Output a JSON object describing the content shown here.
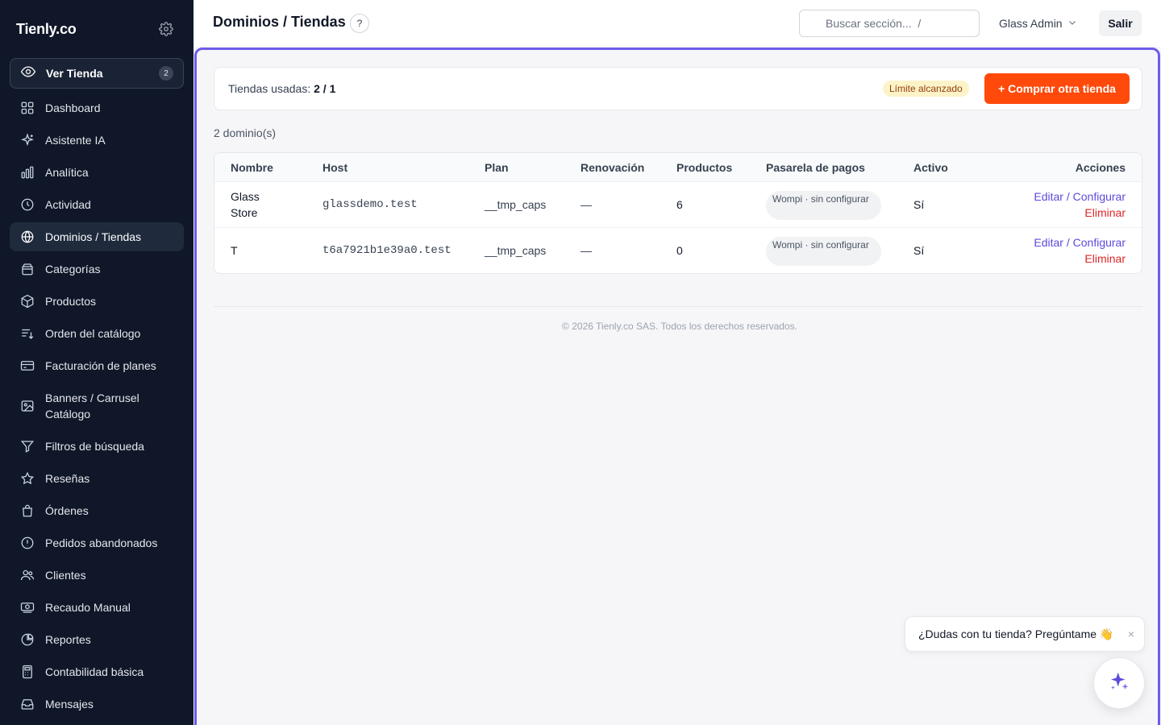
{
  "sidebar": {
    "brand": "Tienly.co",
    "settings_icon": "gear-icon",
    "ver_tienda": {
      "label": "Ver Tienda",
      "count": "2",
      "icon": "eye-icon"
    },
    "items": [
      {
        "label": "Dashboard",
        "icon": "grid-icon",
        "active": false
      },
      {
        "label": "Asistente IA",
        "icon": "sparkles-icon",
        "active": false
      },
      {
        "label": "Analítica",
        "icon": "bar-chart-icon",
        "active": false
      },
      {
        "label": "Actividad",
        "icon": "clock-icon",
        "active": false
      },
      {
        "label": "Dominios / Tiendas",
        "icon": "globe-icon",
        "active": true
      },
      {
        "label": "Categorías",
        "icon": "folder-icon",
        "active": false
      },
      {
        "label": "Productos",
        "icon": "box-icon",
        "active": false
      },
      {
        "label": "Orden del catálogo",
        "icon": "sort-list-icon",
        "active": false
      },
      {
        "label": "Facturación de planes",
        "icon": "credit-card-icon",
        "active": false
      },
      {
        "label": "Banners / Carrusel Catálogo",
        "icon": "image-icon",
        "active": false
      },
      {
        "label": "Filtros de búsqueda",
        "icon": "filter-icon",
        "active": false
      },
      {
        "label": "Reseñas",
        "icon": "star-icon",
        "active": false
      },
      {
        "label": "Órdenes",
        "icon": "shopping-bag-icon",
        "active": false
      },
      {
        "label": "Pedidos abandonados",
        "icon": "alert-circle-icon",
        "active": false
      },
      {
        "label": "Clientes",
        "icon": "users-icon",
        "active": false
      },
      {
        "label": "Recaudo Manual",
        "icon": "cash-icon",
        "active": false
      },
      {
        "label": "Reportes",
        "icon": "pie-chart-icon",
        "active": false
      },
      {
        "label": "Contabilidad básica",
        "icon": "calculator-icon",
        "active": false
      },
      {
        "label": "Mensajes",
        "icon": "inbox-icon",
        "active": false
      }
    ]
  },
  "header": {
    "title": "Dominios / Tiendas",
    "help": "?",
    "search_placeholder": "Buscar sección...  /",
    "user": "Glass Admin",
    "logout": "Salir"
  },
  "usage": {
    "label": "Tiendas usadas: ",
    "value": "2 / 1",
    "limit_badge": "Límite alcanzado",
    "buy_button": "+ Comprar otra tienda"
  },
  "domains_count": "2 dominio(s)",
  "table": {
    "columns": [
      "Nombre",
      "Host",
      "Plan",
      "Renovación",
      "Productos",
      "Pasarela de pagos",
      "Activo",
      "Acciones"
    ],
    "rows": [
      {
        "name": "Glass Store",
        "host": "glassdemo.test",
        "plan": "__tmp_caps",
        "renewal": "—",
        "products": "6",
        "gateway": "Wompi · sin configurar",
        "active": "Sí",
        "edit": "Editar / Configurar",
        "delete": "Eliminar"
      },
      {
        "name": "T",
        "host": "t6a7921b1e39a0.test",
        "plan": "__tmp_caps",
        "renewal": "—",
        "products": "0",
        "gateway": "Wompi · sin configurar",
        "active": "Sí",
        "edit": "Editar / Configurar",
        "delete": "Eliminar"
      }
    ]
  },
  "footer": "© 2026 Tienly.co SAS. Todos los derechos reservados.",
  "chat": {
    "message": "¿Dudas con tu tienda? Pregúntame 👋",
    "close": "×"
  },
  "colors": {
    "sidebar_bg": "#0f1729",
    "accent": "#6d5ce8",
    "primary_button": "#ff4a0b",
    "danger": "#dc2626",
    "link": "#5b4bdb"
  }
}
